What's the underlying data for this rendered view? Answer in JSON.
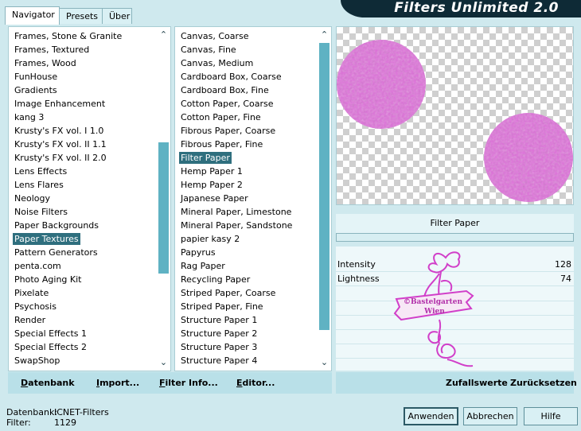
{
  "app_title": "Filters Unlimited 2.0",
  "tabs": [
    {
      "label": "Navigator",
      "active": true
    },
    {
      "label": "Presets",
      "active": false
    },
    {
      "label": "Über",
      "active": false
    }
  ],
  "categories": {
    "items": [
      "Frames, Stone & Granite",
      "Frames, Textured",
      "Frames, Wood",
      "FunHouse",
      "Gradients",
      "Image Enhancement",
      "kang 3",
      "Krusty's FX vol. I 1.0",
      "Krusty's FX vol. II 1.1",
      "Krusty's FX vol. II 2.0",
      "Lens Effects",
      "Lens Flares",
      "Neology",
      "Noise Filters",
      "Paper Backgrounds",
      "Paper Textures",
      "Pattern Generators",
      "penta.com",
      "Photo Aging Kit",
      "Pixelate",
      "Psychosis",
      "Render",
      "Special Effects 1",
      "Special Effects 2",
      "SwapShop"
    ],
    "selected_index": 15,
    "scroll_fraction": 0.55,
    "thumb_fraction": 0.42
  },
  "filters": {
    "items": [
      "Canvas, Coarse",
      "Canvas, Fine",
      "Canvas, Medium",
      "Cardboard Box, Coarse",
      "Cardboard Box, Fine",
      "Cotton Paper, Coarse",
      "Cotton Paper, Fine",
      "Fibrous Paper, Coarse",
      "Fibrous Paper, Fine",
      "Filter Paper",
      "Hemp Paper 1",
      "Hemp Paper 2",
      "Japanese Paper",
      "Mineral Paper, Limestone",
      "Mineral Paper, Sandstone",
      "papier kasy 2",
      "Papyrus",
      "Rag Paper",
      "Recycling Paper",
      "Striped Paper, Coarse",
      "Striped Paper, Fine",
      "Structure Paper 1",
      "Structure Paper 2",
      "Structure Paper 3",
      "Structure Paper 4"
    ],
    "selected_index": 9,
    "scroll_fraction": 0.0,
    "thumb_fraction": 0.92
  },
  "current_filter": "Filter Paper",
  "params": [
    {
      "label": "Intensity",
      "value": "128"
    },
    {
      "label": "Lightness",
      "value": "74"
    }
  ],
  "watermark": {
    "line1": "©Bastelgarten",
    "line2": "Wien"
  },
  "left_actions": [
    {
      "label": "Datenbank"
    },
    {
      "label": "Import..."
    },
    {
      "label": "Filter Info..."
    },
    {
      "label": "Editor..."
    }
  ],
  "right_actions": [
    {
      "label": "Zufallswerte"
    },
    {
      "label": "Zurücksetzen"
    }
  ],
  "info": {
    "db_label": "Datenbank:",
    "db_value": "ICNET-Filters",
    "filter_label": "Filter:",
    "filter_value": "1129"
  },
  "buttons": {
    "apply": "Anwenden",
    "cancel": "Abbrechen",
    "help": "Hilfe"
  },
  "colors": {
    "accent": "#5fb2c3",
    "selection": "#2f6f7e",
    "title_bg": "#0e2a36",
    "preview_circle": "#e070dc",
    "panel": "#cfe9ee"
  }
}
